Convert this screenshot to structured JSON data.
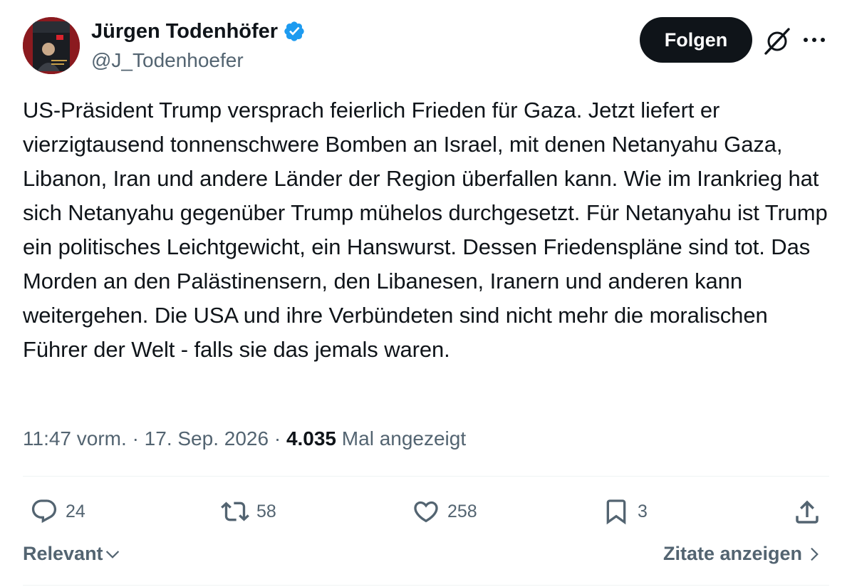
{
  "author": {
    "name": "Jürgen Todenhöfer",
    "handle": "@J_Todenhoefer",
    "avatar_book_title": "JÜRGEN TODENHÖFER",
    "verified_icon": "verified-badge-icon"
  },
  "header": {
    "follow_label": "Folgen",
    "grok_icon": "grok-icon",
    "more_icon": "more-icon"
  },
  "tweet": {
    "text": "US-Präsident Trump versprach feierlich Frieden für Gaza. Jetzt liefert er vierzigtausend tonnenschwere Bomben an Israel, mit denen Netanyahu Gaza, Libanon, Iran und andere Länder der Region überfallen kann. Wie im Irankrieg hat sich Netanyahu gegenüber Trump mühelos durchgesetzt. Für Netanyahu ist Trump ein politisches Leichtgewicht, ein Hanswurst. Dessen Friedenspläne sind tot. Das Morden an den Palästinensern, den Libanesen, Iranern und anderen kann weitergehen. Die USA und ihre Verbündeten sind nicht mehr die moralischen Führer der Welt - falls sie das jemals waren.",
    "time": "11:47 vorm.",
    "separator": "·",
    "date": "17. Sep. 2026",
    "views": "4.035",
    "views_label": "Mal angezeigt"
  },
  "actions": {
    "replies": "24",
    "reposts": "58",
    "likes": "258",
    "bookmarks": "3"
  },
  "footer": {
    "sort_label": "Relevant",
    "quotes_label": "Zitate anzeigen"
  },
  "colors": {
    "text": "#0f1419",
    "secondary": "#536471",
    "verified": "#1d9bf0",
    "divider": "#eff3f4"
  }
}
